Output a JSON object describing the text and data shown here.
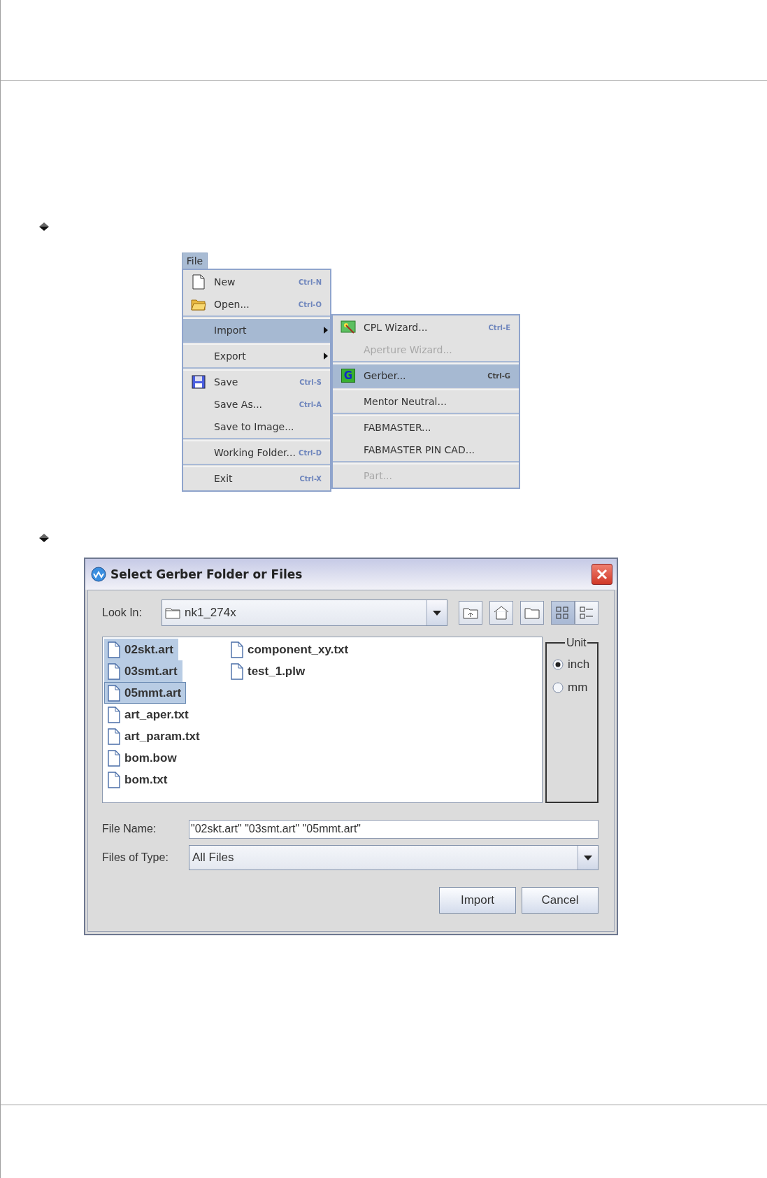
{
  "menu": {
    "title": "File",
    "title_selected": true,
    "groups": [
      [
        {
          "label": "New",
          "shortcut": "Ctrl-N",
          "selected": false,
          "submenu": false
        },
        {
          "label": "Open...",
          "shortcut": "Ctrl-O",
          "selected": false,
          "submenu": false
        }
      ],
      [
        {
          "label": "Import",
          "selected": true,
          "submenu": true
        }
      ],
      [
        {
          "label": "Export",
          "selected": false,
          "submenu": true
        }
      ],
      [
        {
          "label": "Save",
          "shortcut": "Ctrl-S",
          "selected": false,
          "submenu": false
        },
        {
          "label": "Save As...",
          "shortcut": "Ctrl-A",
          "selected": false,
          "submenu": false
        },
        {
          "label": "Save to Image...",
          "selected": false,
          "submenu": false
        }
      ],
      [
        {
          "label": "Working Folder...",
          "shortcut": "Ctrl-D",
          "selected": false,
          "submenu": false
        }
      ],
      [
        {
          "label": "Exit",
          "shortcut": "Ctrl-X",
          "selected": false,
          "submenu": false
        }
      ]
    ]
  },
  "submenu": {
    "groups": [
      [
        {
          "label": "CPL Wizard...",
          "shortcut": "Ctrl-E",
          "selected": false,
          "disabled": false
        },
        {
          "label": "Aperture Wizard...",
          "selected": false,
          "disabled": true
        }
      ],
      [
        {
          "label": "Gerber...",
          "badge": "G",
          "shortcut": "Ctrl-G",
          "selected": true,
          "disabled": false
        }
      ],
      [
        {
          "label": "Mentor Neutral...",
          "selected": false,
          "disabled": false
        }
      ],
      [
        {
          "label": "FABMASTER...",
          "selected": false,
          "disabled": false
        },
        {
          "label": "FABMASTER PIN CAD...",
          "selected": false,
          "disabled": false
        }
      ],
      [
        {
          "label": "Part...",
          "selected": false,
          "disabled": true
        }
      ]
    ]
  },
  "dialog": {
    "title": "Select Gerber Folder or Files",
    "look_in_label": "Look In:",
    "look_in_value": "nk1_274x",
    "view_buttons": [
      {
        "selected": true
      },
      {
        "selected": false
      }
    ],
    "files": [
      {
        "name": "02skt.art",
        "selected": true,
        "focused": false
      },
      {
        "name": "03smt.art",
        "selected": true,
        "focused": false
      },
      {
        "name": "05mmt.art",
        "selected": true,
        "focused": true
      },
      {
        "name": "art_aper.txt",
        "selected": false,
        "focused": false
      },
      {
        "name": "art_param.txt",
        "selected": false,
        "focused": false
      },
      {
        "name": "bom.bow",
        "selected": false,
        "focused": false
      },
      {
        "name": "bom.txt",
        "selected": false,
        "focused": false
      },
      {
        "name": "component_xy.txt",
        "selected": false,
        "focused": false
      },
      {
        "name": "test_1.plw",
        "selected": false,
        "focused": false
      }
    ],
    "unit": {
      "title": "Unit",
      "options": [
        {
          "label": "inch",
          "selected": true
        },
        {
          "label": "mm",
          "selected": false
        }
      ]
    },
    "file_name_label": "File Name:",
    "file_name_value": "\"02skt.art\" \"03smt.art\" \"05mmt.art\"",
    "files_of_type_label": "Files of Type:",
    "files_of_type_value": "All Files",
    "buttons": [
      "Import",
      "Cancel"
    ]
  }
}
